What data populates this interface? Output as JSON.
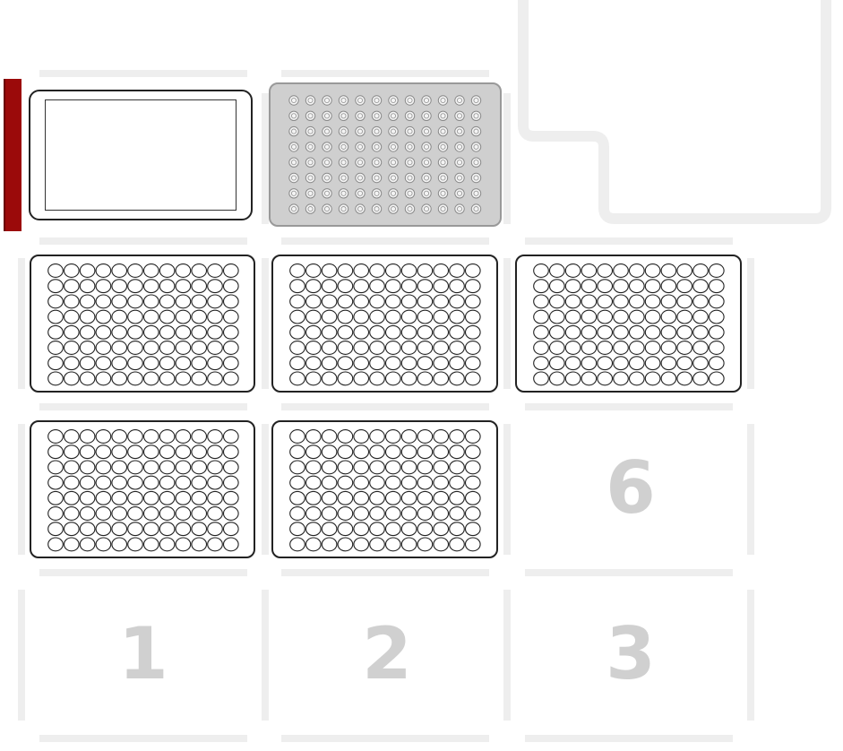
{
  "deck": {
    "slot_labels": {
      "slot1": "1",
      "slot2": "2",
      "slot3": "3",
      "slot6": "6"
    },
    "colors": {
      "slot_border": "#eeeeee",
      "slot_label": "#d0d0d0",
      "selected_marker": "#9b0a0a",
      "tiprack_fill": "#cfcfcf",
      "labware_outline": "#222222"
    },
    "labware": [
      {
        "slot": "10",
        "type": "tip-box",
        "selected": true
      },
      {
        "slot": "11",
        "type": "tip-rack",
        "rows": 8,
        "cols": 12
      },
      {
        "slot": "7",
        "type": "well-plate",
        "rows": 8,
        "cols": 12
      },
      {
        "slot": "8",
        "type": "well-plate",
        "rows": 8,
        "cols": 12
      },
      {
        "slot": "9",
        "type": "well-plate",
        "rows": 8,
        "cols": 12
      },
      {
        "slot": "4",
        "type": "well-plate",
        "rows": 8,
        "cols": 12
      },
      {
        "slot": "5",
        "type": "well-plate",
        "rows": 8,
        "cols": 12
      }
    ],
    "trash": {
      "slot": "12",
      "type": "fixed-trash"
    }
  }
}
